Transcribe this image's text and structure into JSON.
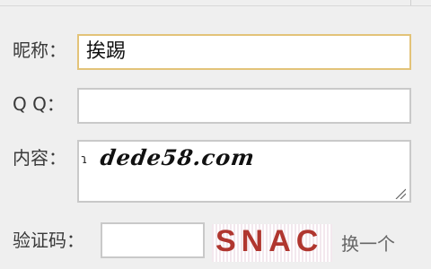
{
  "form": {
    "nickname_label": "昵称：",
    "nickname_value": "挨踢",
    "qq_label": "Q Q：",
    "qq_value": "",
    "content_label": "内容：",
    "content_watermark": "dede58.com",
    "captcha_label": "验证码：",
    "captcha_input_value": "",
    "captcha_text": "SNAC",
    "captcha_refresh_label": "换一个"
  },
  "colors": {
    "focus_border": "#e3c378",
    "captcha_text": "#b0362f"
  }
}
